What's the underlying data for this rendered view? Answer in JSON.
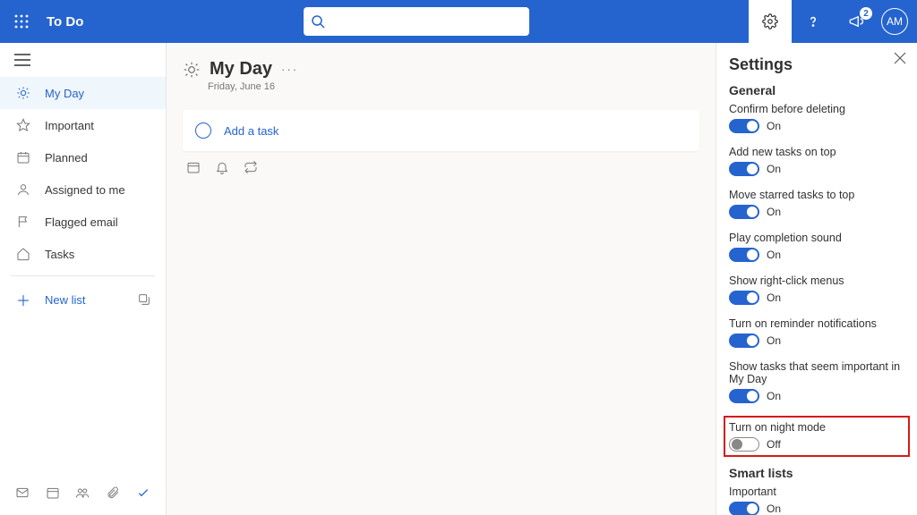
{
  "header": {
    "app_title": "To Do",
    "search_placeholder": "",
    "news_badge": "2",
    "avatar_initials": "AM"
  },
  "sidebar": {
    "items": [
      {
        "label": "My Day"
      },
      {
        "label": "Important"
      },
      {
        "label": "Planned"
      },
      {
        "label": "Assigned to me"
      },
      {
        "label": "Flagged email"
      },
      {
        "label": "Tasks"
      }
    ],
    "new_list_label": "New list"
  },
  "main": {
    "title": "My Day",
    "date": "Friday, June 16",
    "add_task_placeholder": "Add a task"
  },
  "settings": {
    "title": "Settings",
    "section_general": "General",
    "section_smart": "Smart lists",
    "items": [
      {
        "label": "Confirm before deleting",
        "state_text": "On",
        "on": true
      },
      {
        "label": "Add new tasks on top",
        "state_text": "On",
        "on": true
      },
      {
        "label": "Move starred tasks to top",
        "state_text": "On",
        "on": true
      },
      {
        "label": "Play completion sound",
        "state_text": "On",
        "on": true
      },
      {
        "label": "Show right-click menus",
        "state_text": "On",
        "on": true
      },
      {
        "label": "Turn on reminder notifications",
        "state_text": "On",
        "on": true
      },
      {
        "label": "Show tasks that seem important in My Day",
        "state_text": "On",
        "on": true
      },
      {
        "label": "Turn on night mode",
        "state_text": "Off",
        "on": false,
        "highlight": true
      }
    ],
    "smart_items": [
      {
        "label": "Important",
        "state_text": "On",
        "on": true
      }
    ]
  }
}
